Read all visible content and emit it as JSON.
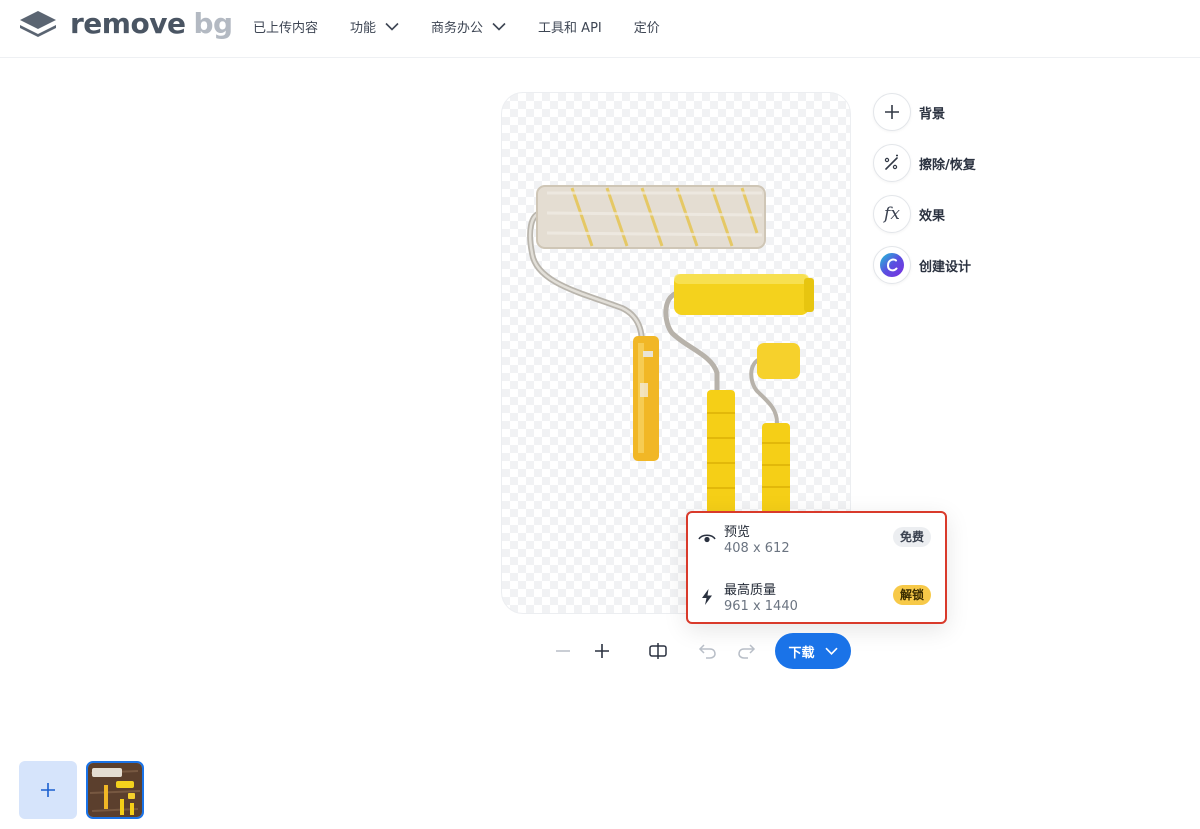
{
  "brand": {
    "name_part1": "remove",
    "name_part2": "bg"
  },
  "nav": {
    "uploads": "已上传内容",
    "features": "功能",
    "business": "商务办公",
    "tools_api": "工具和 API",
    "pricing": "定价"
  },
  "side_tools": {
    "background": "背景",
    "erase_restore": "擦除/恢复",
    "effects": "效果",
    "create_design": "创建设计"
  },
  "download_menu": {
    "preview": {
      "title": "预览",
      "size": "408 x 612",
      "badge": "免费"
    },
    "max_quality": {
      "title": "最高质量",
      "size": "961 x 1440",
      "badge": "解锁"
    }
  },
  "toolbar": {
    "download_label": "下载"
  },
  "colors": {
    "accent": "#1a73e8",
    "highlight_border": "#d93a2b",
    "unlock_badge": "#f7c948"
  }
}
